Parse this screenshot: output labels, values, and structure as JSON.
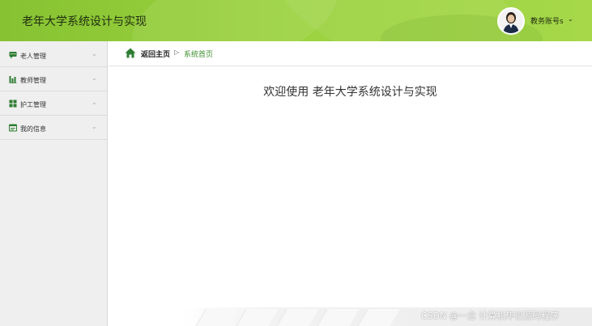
{
  "header": {
    "app_title": "老年大学系统设计与实现",
    "user_name": "教务账号s",
    "user_caret": "⌄",
    "accent": "#8fca37"
  },
  "sidebar": {
    "items": [
      {
        "label": "老人管理",
        "icon": "chat-icon"
      },
      {
        "label": "教师管理",
        "icon": "bar-chart-icon"
      },
      {
        "label": "护工管理",
        "icon": "grid-icon"
      },
      {
        "label": "我的信息",
        "icon": "id-card-icon"
      }
    ],
    "caret": "⌄"
  },
  "breadcrumb": {
    "home": "返回主页",
    "separator": "▷",
    "current": "系统首页"
  },
  "main": {
    "welcome": "欢迎使用 老年大学系统设计与实现"
  },
  "footer": {
    "watermark": "CSDN @一念 计算机毕设源码程序"
  }
}
